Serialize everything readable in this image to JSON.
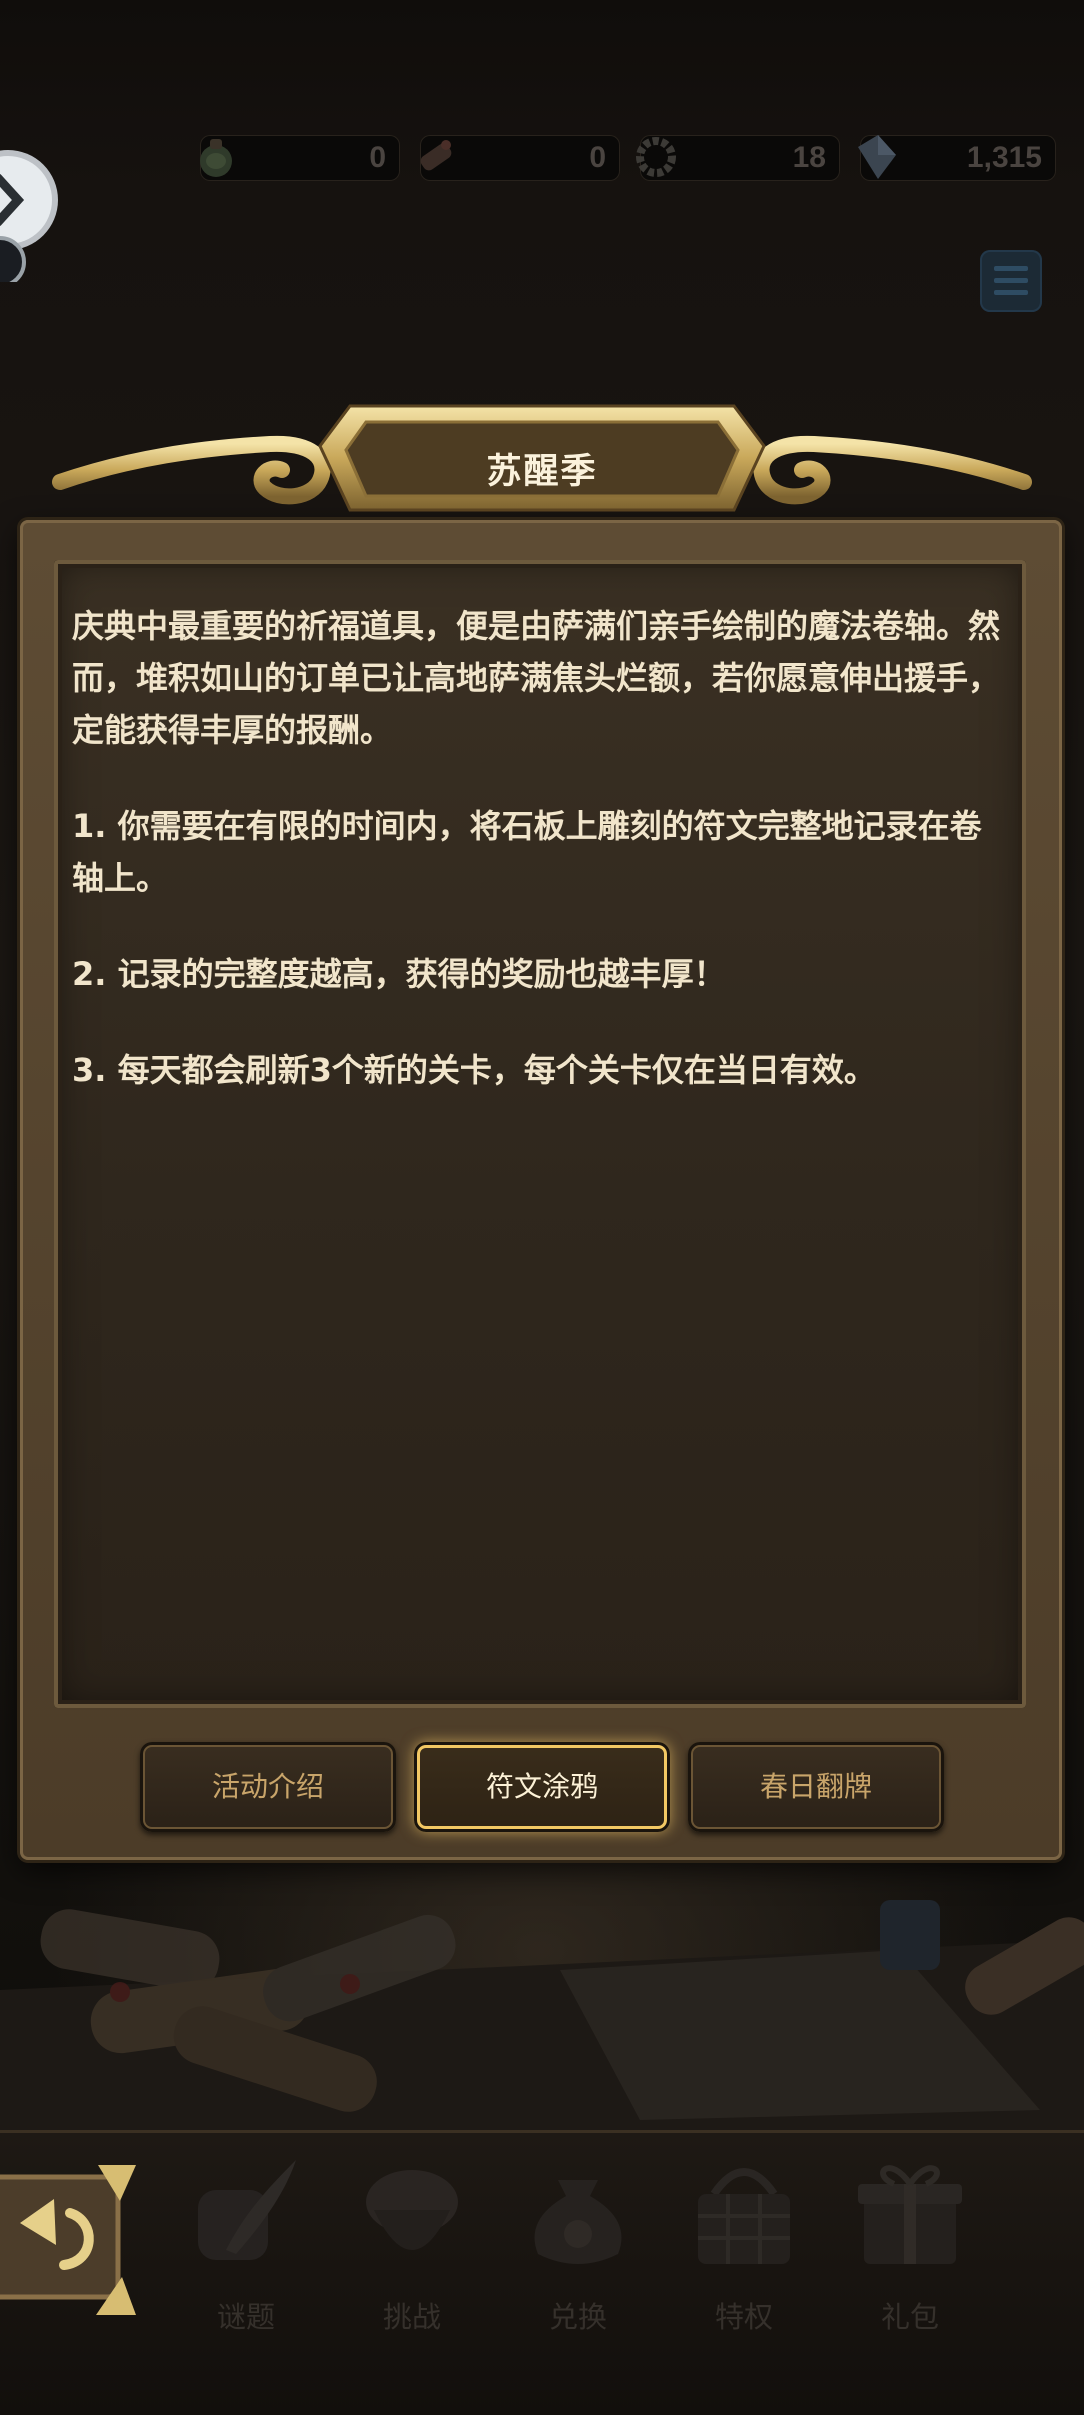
{
  "resources": [
    {
      "icon": "green-potion-icon",
      "value": "0"
    },
    {
      "icon": "scroll-icon",
      "value": "0"
    },
    {
      "icon": "wreath-icon",
      "value": "18"
    },
    {
      "icon": "crystal-icon",
      "value": "1,315"
    }
  ],
  "panel": {
    "title": "苏醒季",
    "paragraphs": [
      "庆典中最重要的祈福道具，便是由萨满们亲手绘制的魔法卷轴。然而，堆积如山的订单已让高地萨满焦头烂额，若你愿意伸出援手，定能获得丰厚的报酬。",
      "1. 你需要在有限的时间内，将石板上雕刻的符文完整地记录在卷轴上。",
      "2. 记录的完整度越高，获得的奖励也越丰厚！",
      "3. 每天都会刷新3个新的关卡，每个关卡仅在当日有效。"
    ],
    "tabs": [
      {
        "label": "活动介绍",
        "active": false
      },
      {
        "label": "符文涂鸦",
        "active": true
      },
      {
        "label": "春日翻牌",
        "active": false
      }
    ]
  },
  "bottom_nav": [
    {
      "label": "谜题",
      "icon": "feather-scroll-icon"
    },
    {
      "label": "挑战",
      "icon": "acorn-icon"
    },
    {
      "label": "兑换",
      "icon": "money-bag-icon"
    },
    {
      "label": "特权",
      "icon": "basket-icon"
    },
    {
      "label": "礼包",
      "icon": "gift-box-icon"
    }
  ],
  "colors": {
    "panel_wood": "#5e4c34",
    "active_tab_glow": "#f2c864",
    "inactive_tab_text": "#c9a56a"
  }
}
